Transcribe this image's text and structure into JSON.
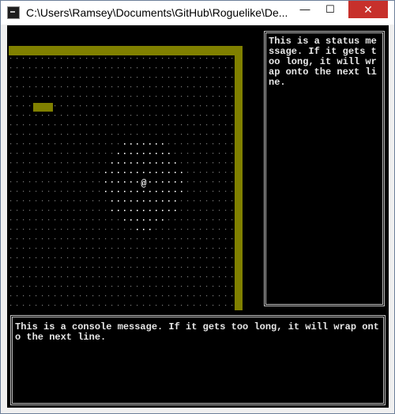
{
  "window": {
    "title": "C:\\Users\\Ramsey\\Documents\\GitHub\\Roguelike\\De...",
    "minimize_glyph": "—",
    "maximize_glyph": "☐",
    "close_glyph": "✕"
  },
  "game": {
    "player_glyph": "@",
    "floor_glyph": ".",
    "status_message": "This is a status message. If it gets too long, it will wrap onto the next line.",
    "console_message": "This is a console message. If it gets too long, it will wrap onto the next line."
  },
  "colors": {
    "wall": "#808000",
    "floor_dim": "#7a7a7a",
    "floor_lit": "#ffffff",
    "player": "#ffffff",
    "background": "#000000",
    "close_button": "#c7302b"
  }
}
